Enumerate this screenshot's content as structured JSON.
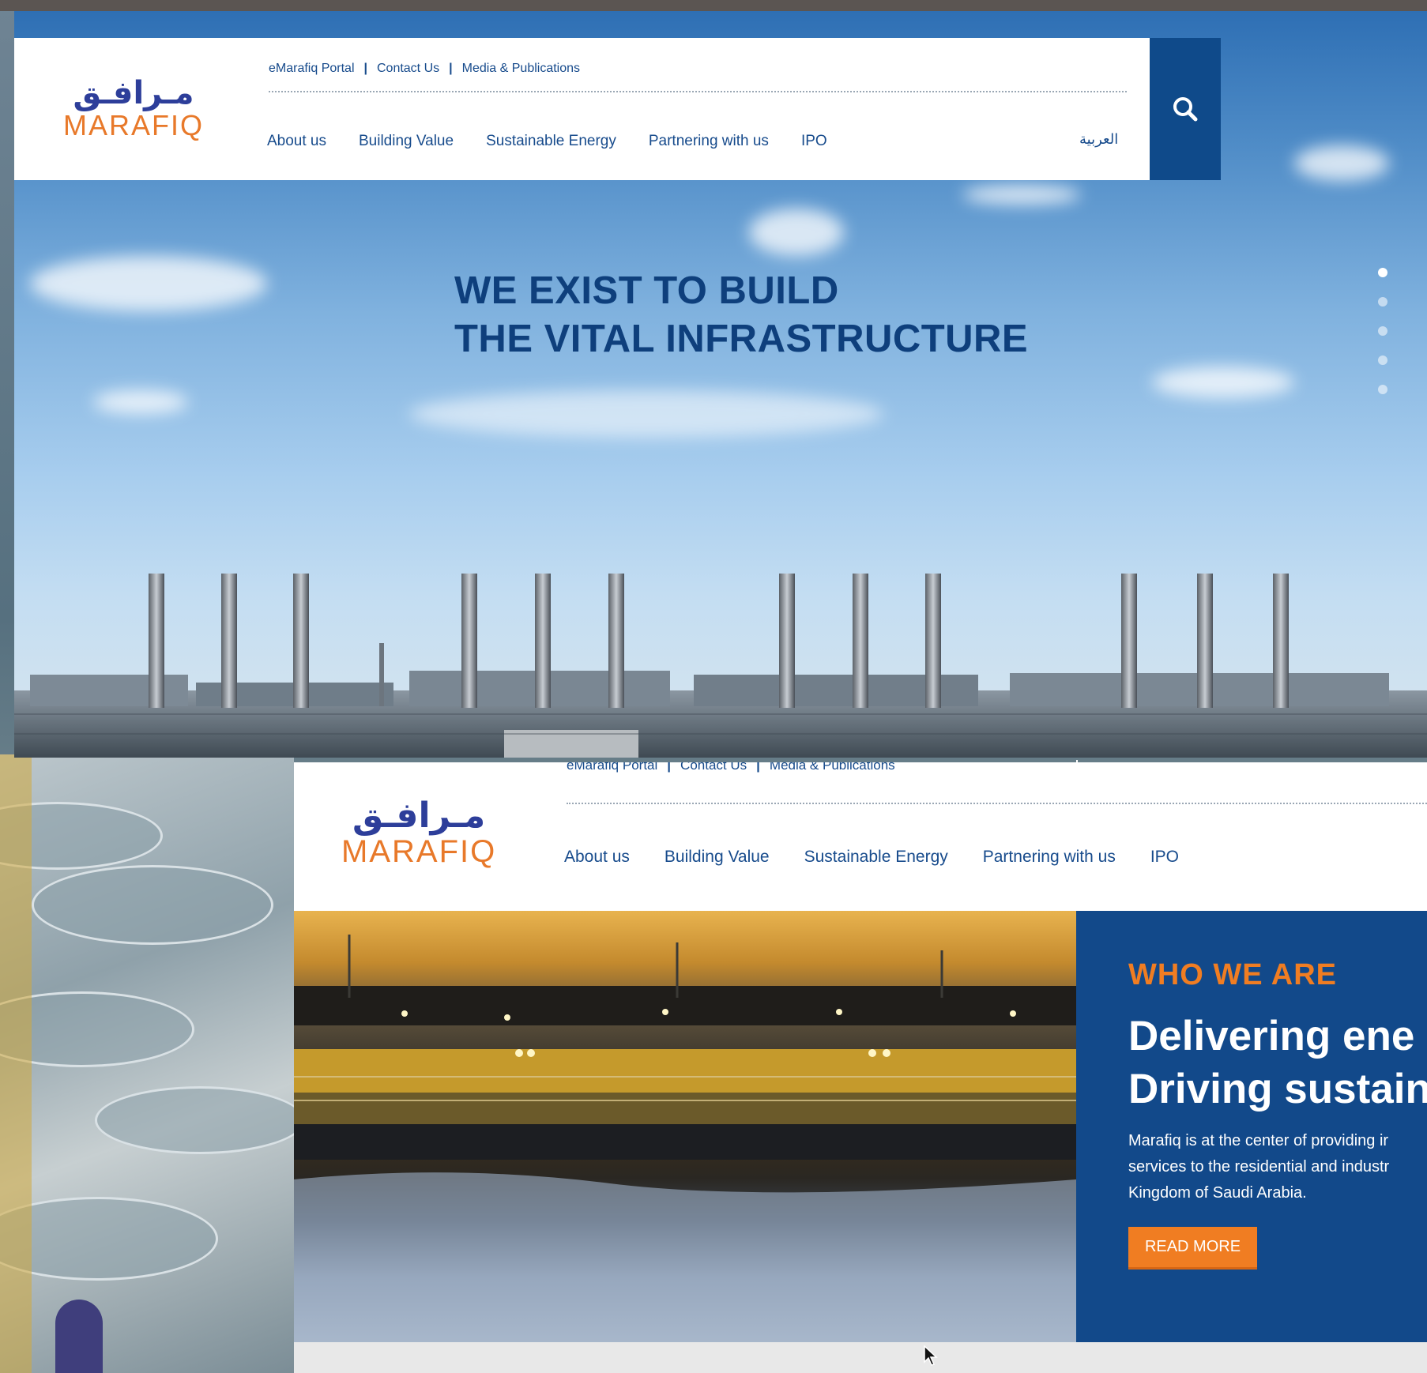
{
  "screen1": {
    "logo": {
      "arabic": "مـرافـق",
      "english": "MARAFIQ"
    },
    "top_links": [
      "eMarafiq Portal",
      "Contact Us",
      "Media & Publications"
    ],
    "nav": [
      "About us",
      "Building Value",
      "Sustainable Energy",
      "Partnering with us",
      "IPO"
    ],
    "language": "العربية",
    "search_icon": "search-icon",
    "hero": {
      "line1": "WE EXIST TO BUILD",
      "line2": "THE VITAL INFRASTRUCTURE"
    },
    "slider": {
      "count": 5,
      "active_index": 0
    }
  },
  "screen2": {
    "logo": {
      "arabic": "مـرافـق",
      "english": "MARAFIQ"
    },
    "top_links": [
      "eMarafiq Portal",
      "Contact Us",
      "Media & Publications"
    ],
    "nav": [
      "About us",
      "Building Value",
      "Sustainable Energy",
      "Partnering with us",
      "IPO"
    ],
    "who": {
      "tag": "WHO WE ARE",
      "heading_line1": "Delivering ene",
      "heading_line2": "Driving sustain",
      "para_line1": "Marafiq is at the center of providing ir",
      "para_line2": "services to the residential and industr",
      "para_line3": "Kingdom of Saudi Arabia.",
      "button": "READ MORE"
    }
  },
  "colors": {
    "brand_blue": "#174b8c",
    "dark_blue": "#0f4a8a",
    "orange": "#f07d22",
    "logo_purple": "#2d3e9a"
  }
}
